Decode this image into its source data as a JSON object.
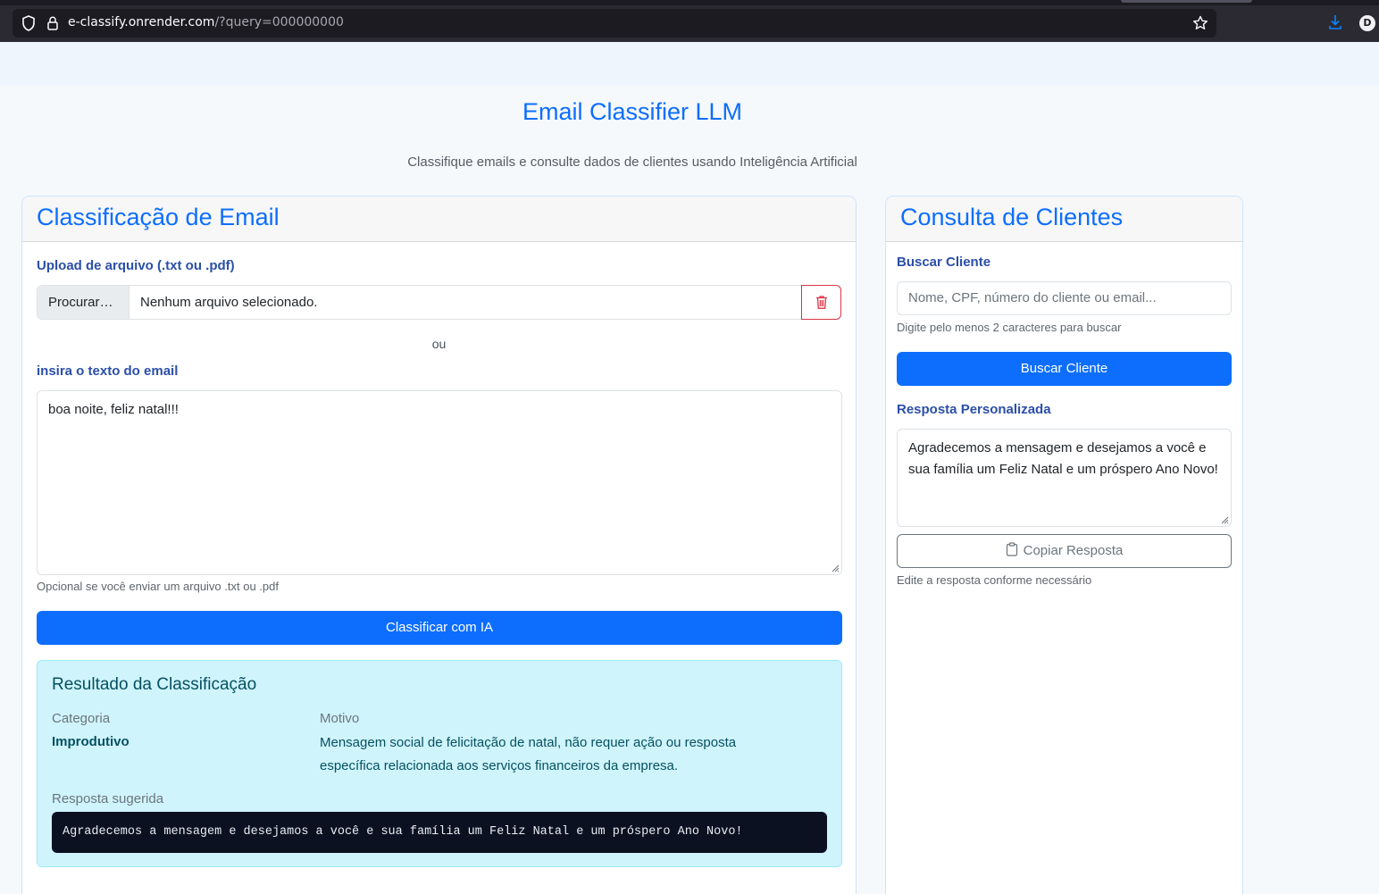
{
  "browser": {
    "url_host": "e-classify.onrender.com",
    "url_rest": "/?query=000000000",
    "profile_initial": "D"
  },
  "header": {
    "title": "Email Classifier LLM",
    "subtitle": "Classifique emails e consulte dados de clientes usando Inteligência Artificial"
  },
  "classification": {
    "card_title": "Classificação de Email",
    "upload_label": "Upload de arquivo (.txt ou .pdf)",
    "browse_button": "Procurar…",
    "file_status": "Nenhum arquivo selecionado.",
    "or_text": "ou",
    "text_label": "insira o texto do email",
    "email_text": "boa noite, feliz natal!!!",
    "text_help": "Opcional se você enviar um arquivo .txt ou .pdf",
    "classify_button": "Classificar com IA",
    "result": {
      "title": "Resultado da Classificação",
      "category_label": "Categoria",
      "category_value": "Improdutivo",
      "reason_label": "Motivo",
      "reason_value": "Mensagem social de felicitação de natal, não requer ação ou resposta específica relacionada aos serviços financeiros da empresa.",
      "suggested_label": "Resposta sugerida",
      "suggested_value": "Agradecemos a mensagem e desejamos a você e sua família um Feliz Natal e um próspero Ano Novo!"
    }
  },
  "clients": {
    "card_title": "Consulta de Clientes",
    "search_label": "Buscar Cliente",
    "search_placeholder": "Nome, CPF, número do cliente ou email...",
    "search_help": "Digite pelo menos 2 caracteres para buscar",
    "search_button": "Buscar Cliente",
    "response_label": "Resposta Personalizada",
    "response_text": "Agradecemos a mensagem e desejamos a você e sua família um Feliz Natal e um próspero Ano Novo!",
    "copy_button": "Copiar Resposta",
    "response_help": "Edite a resposta conforme necessário"
  },
  "icons": {
    "trash": "trash-icon",
    "clipboard": "clipboard-icon",
    "shield": "shield-icon",
    "lock": "lock-icon",
    "star": "star-icon",
    "download": "download-icon"
  },
  "colors": {
    "primary": "#0d6efd",
    "danger": "#dc3545",
    "info_bg": "#cff4fc",
    "info_text": "#055160",
    "label": "#2b4fa8"
  }
}
